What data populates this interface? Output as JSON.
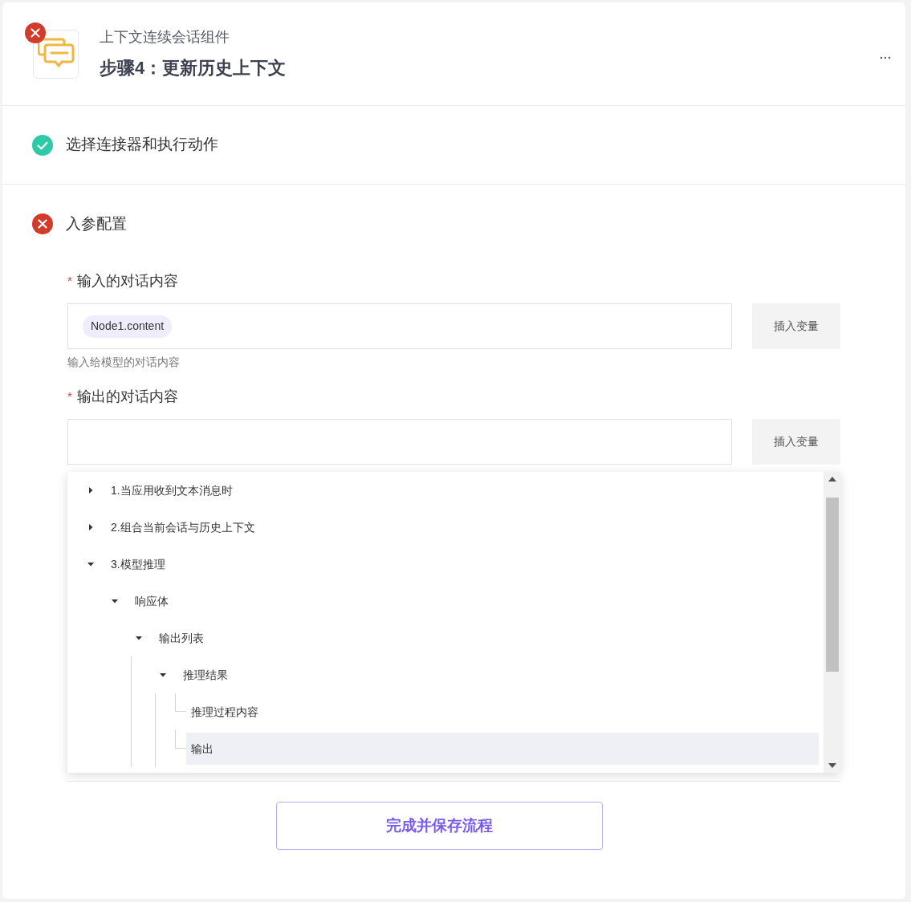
{
  "header": {
    "subtitle": "上下文连续会话组件",
    "title": "步骤4：更新历史上下文",
    "error": true
  },
  "steps": [
    {
      "label": "选择连接器和执行动作",
      "complete": true
    },
    {
      "label": "入参配置",
      "complete": false
    }
  ],
  "fields": [
    {
      "required_mark": "*",
      "label": "输入的对话内容",
      "tags": [
        "Node1.content"
      ],
      "button": "插入变量",
      "help": "输入给模型的对话内容"
    },
    {
      "required_mark": "*",
      "label": "输出的对话内容",
      "button": "插入变量"
    }
  ],
  "variable_tree": [
    {
      "label": "1.当应用收到文本消息时",
      "expanded": false,
      "selected": false
    },
    {
      "label": "2.组合当前会话与历史上下文",
      "expanded": false,
      "selected": false
    },
    {
      "label": "3.模型推理",
      "expanded": true,
      "selected": false,
      "children": [
        {
          "label": "响应体",
          "expanded": true,
          "selected": false,
          "children": [
            {
              "label": "输出列表",
              "expanded": true,
              "selected": false,
              "children": [
                {
                  "label": "推理结果",
                  "expanded": true,
                  "selected": false,
                  "children": [
                    {
                      "label": "推理过程内容",
                      "selected": false
                    },
                    {
                      "label": "输出",
                      "selected": true
                    }
                  ]
                }
              ]
            }
          ]
        }
      ]
    }
  ],
  "submit_button": "完成并保存流程"
}
